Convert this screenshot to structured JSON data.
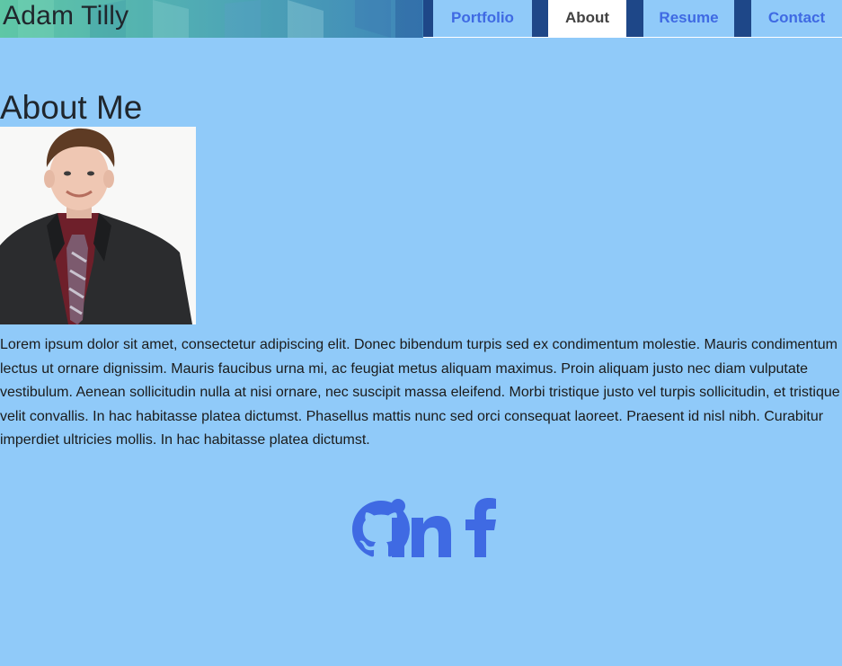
{
  "header": {
    "title": "Adam Tilly"
  },
  "nav": {
    "items": [
      {
        "label": "Portfolio",
        "active": false
      },
      {
        "label": "About",
        "active": true
      },
      {
        "label": "Resume",
        "active": false
      },
      {
        "label": "Contact",
        "active": false
      }
    ]
  },
  "main": {
    "heading": "About Me",
    "bio": "Lorem ipsum dolor sit amet, consectetur adipiscing elit. Donec bibendum turpis sed ex condimentum molestie. Mauris condimentum lectus ut ornare dignissim. Mauris faucibus urna mi, ac feugiat metus aliquam maximus. Proin aliquam justo nec diam vulputate vestibulum. Aenean sollicitudin nulla at nisi ornare, nec suscipit massa eleifend. Morbi tristique justo vel turpis sollicitudin, et tristique velit convallis. In hac habitasse platea dictumst. Phasellus mattis nunc sed orci consequat laoreet. Praesent id nisl nibh. Curabitur imperdiet ultricies mollis. In hac habitasse platea dictumst."
  },
  "social": {
    "links": [
      {
        "icon": "github-icon"
      },
      {
        "icon": "linkedin-icon"
      },
      {
        "icon": "facebook-icon"
      }
    ],
    "icon_color": "#3f6ae3"
  },
  "colors": {
    "page_background": "#90caf9",
    "nav_text": "#3f6ae3",
    "nav_active_background": "#ffffff",
    "nav_active_text": "#424242"
  }
}
